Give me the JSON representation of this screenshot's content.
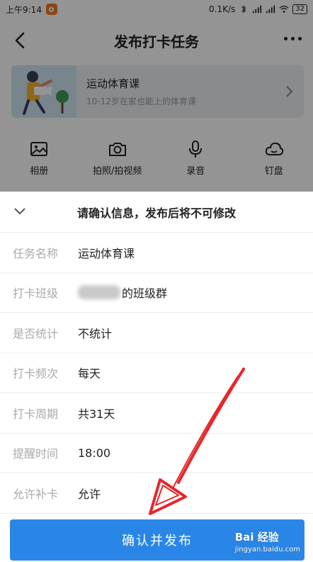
{
  "status": {
    "time": "上午9:14",
    "speed": "0.1K/s",
    "battery": "32"
  },
  "header": {
    "title": "发布打卡任务"
  },
  "course": {
    "title": "运动体育课",
    "subtitle": "10-12岁在家也能上的体育课"
  },
  "tools": [
    {
      "icon": "image-icon",
      "label": "相册"
    },
    {
      "icon": "camera-icon",
      "label": "拍照/拍视频"
    },
    {
      "icon": "microphone-icon",
      "label": "录音"
    },
    {
      "icon": "cloud-icon",
      "label": "钉盘"
    }
  ],
  "sheet": {
    "title": "请确认信息，发布后将不可修改",
    "rows": [
      {
        "key": "任务名称",
        "value": "运动体育课"
      },
      {
        "key": "打卡班级",
        "value": "的班级群"
      },
      {
        "key": "是否统计",
        "value": "不统计"
      },
      {
        "key": "打卡频次",
        "value": "每天"
      },
      {
        "key": "打卡周期",
        "value": "共31天"
      },
      {
        "key": "提醒时间",
        "value": "18:00"
      },
      {
        "key": "允许补卡",
        "value": "允许"
      }
    ],
    "confirm_label": "确认并发布"
  },
  "watermark": {
    "brand": "Bai 经验",
    "url": "jingyan.baidu.com"
  },
  "colors": {
    "primary": "#2a86e6",
    "annotation": "#e8262b"
  }
}
